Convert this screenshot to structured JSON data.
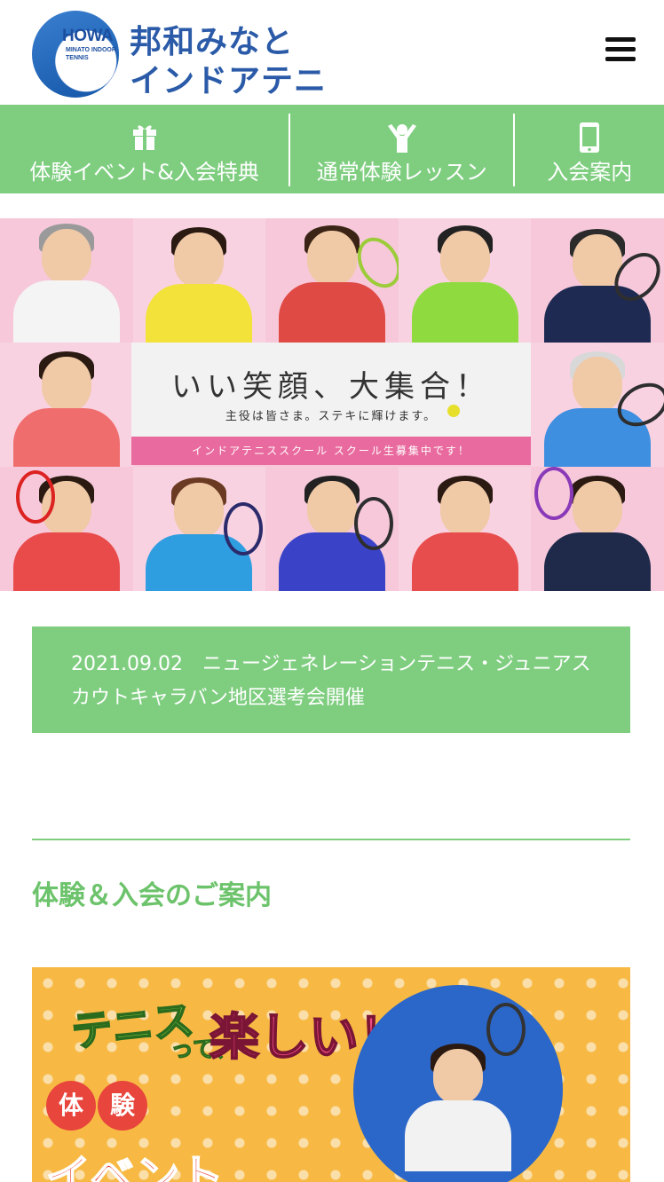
{
  "logo": {
    "badge": "HOWA",
    "badge_sub": "MINATO INDOOR TENNIS",
    "name_line1": "邦和みなと",
    "name_line2": "インドアテニス"
  },
  "nav": {
    "items": [
      {
        "label": "体験イベント&入会特典",
        "icon": "gift-icon"
      },
      {
        "label": "通常体験レッスン",
        "icon": "person-cheer-icon"
      },
      {
        "label": "入会案内",
        "icon": "smartphone-icon"
      }
    ]
  },
  "hero": {
    "title": "いい笑顔、大集合！",
    "subtitle": "主役は皆さま。ステキに輝けます。",
    "band": "インドアテニススクール スクール生募集中です！"
  },
  "news": {
    "date": "2021.09.02",
    "title": "ニュージェネレーションテニス・ジュニアスカウトキャラバン地区選考会開催"
  },
  "section": {
    "title": "体験＆入会のご案内"
  },
  "banner": {
    "line1": "テニス",
    "line1b": "って、",
    "line2": "楽しい！",
    "badge1": "体",
    "badge2": "験",
    "event": "イベント"
  },
  "colors": {
    "green": "#7fce80",
    "green_text": "#6cc36b",
    "pink_bg": "#f6c8da",
    "pink_band": "#e96a9e",
    "logo_blue": "#2b5ba8"
  }
}
